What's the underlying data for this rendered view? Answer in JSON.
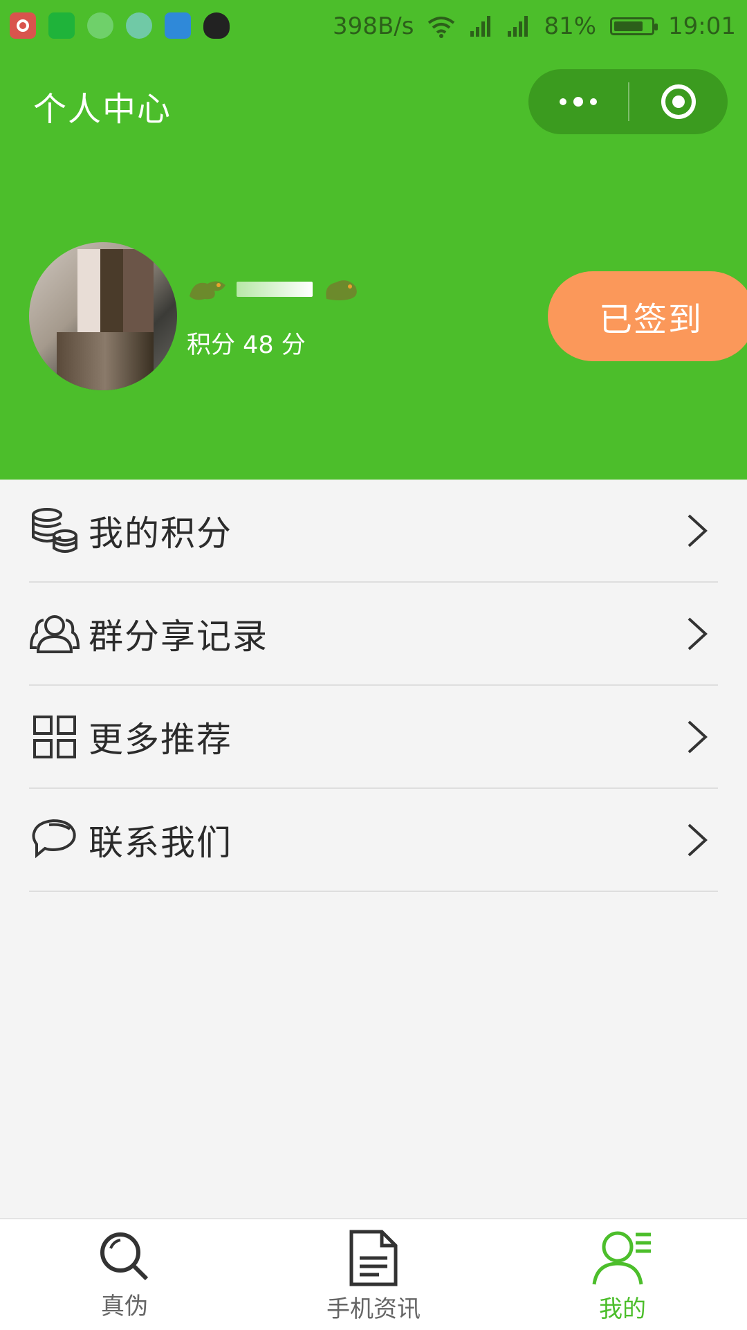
{
  "status_bar": {
    "net_speed": "398B/s",
    "battery_percent": "81%",
    "battery_level": 0.81,
    "time": "19:01",
    "app_icons": [
      "record-app-icon",
      "wechat-icon",
      "chat-bubble-icon",
      "message-icon",
      "shield-icon",
      "qq-icon"
    ]
  },
  "header": {
    "title": "个人中心",
    "colors": {
      "primary": "#4cbe2b",
      "capsule": "#3b9b1f",
      "checkin": "#fb985a"
    }
  },
  "profile": {
    "points_text": "积分 48 分",
    "checkin_label": "已签到"
  },
  "menu": {
    "items": [
      {
        "label": "我的积分",
        "icon": "coins-icon"
      },
      {
        "label": "群分享记录",
        "icon": "group-icon"
      },
      {
        "label": "更多推荐",
        "icon": "grid-icon"
      },
      {
        "label": "联系我们",
        "icon": "chat-icon"
      }
    ]
  },
  "tabbar": {
    "tabs": [
      {
        "label": "真伪",
        "icon": "search-icon"
      },
      {
        "label": "手机资讯",
        "icon": "document-icon"
      },
      {
        "label": "我的",
        "icon": "user-icon",
        "active": true
      }
    ]
  }
}
